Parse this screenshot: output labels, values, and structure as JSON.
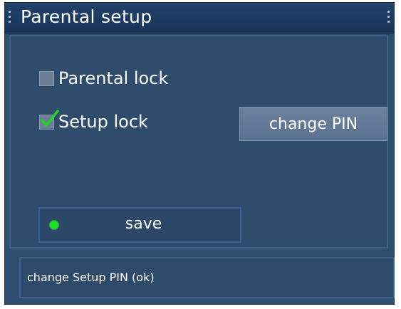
{
  "window": {
    "title": "Parental setup"
  },
  "options": {
    "parental_lock": {
      "label": "Parental lock",
      "checked": false
    },
    "setup_lock": {
      "label": "Setup lock",
      "checked": true
    }
  },
  "buttons": {
    "change_pin_label": "change PIN",
    "save_label": "save"
  },
  "status": {
    "text": "change Setup PIN (ok)"
  },
  "colors": {
    "background": "#2f4d6d",
    "titlebar": "#1b3a60",
    "button": "#6c819e",
    "focus_dot": "#17e31f",
    "checkmark": "#22d422"
  }
}
